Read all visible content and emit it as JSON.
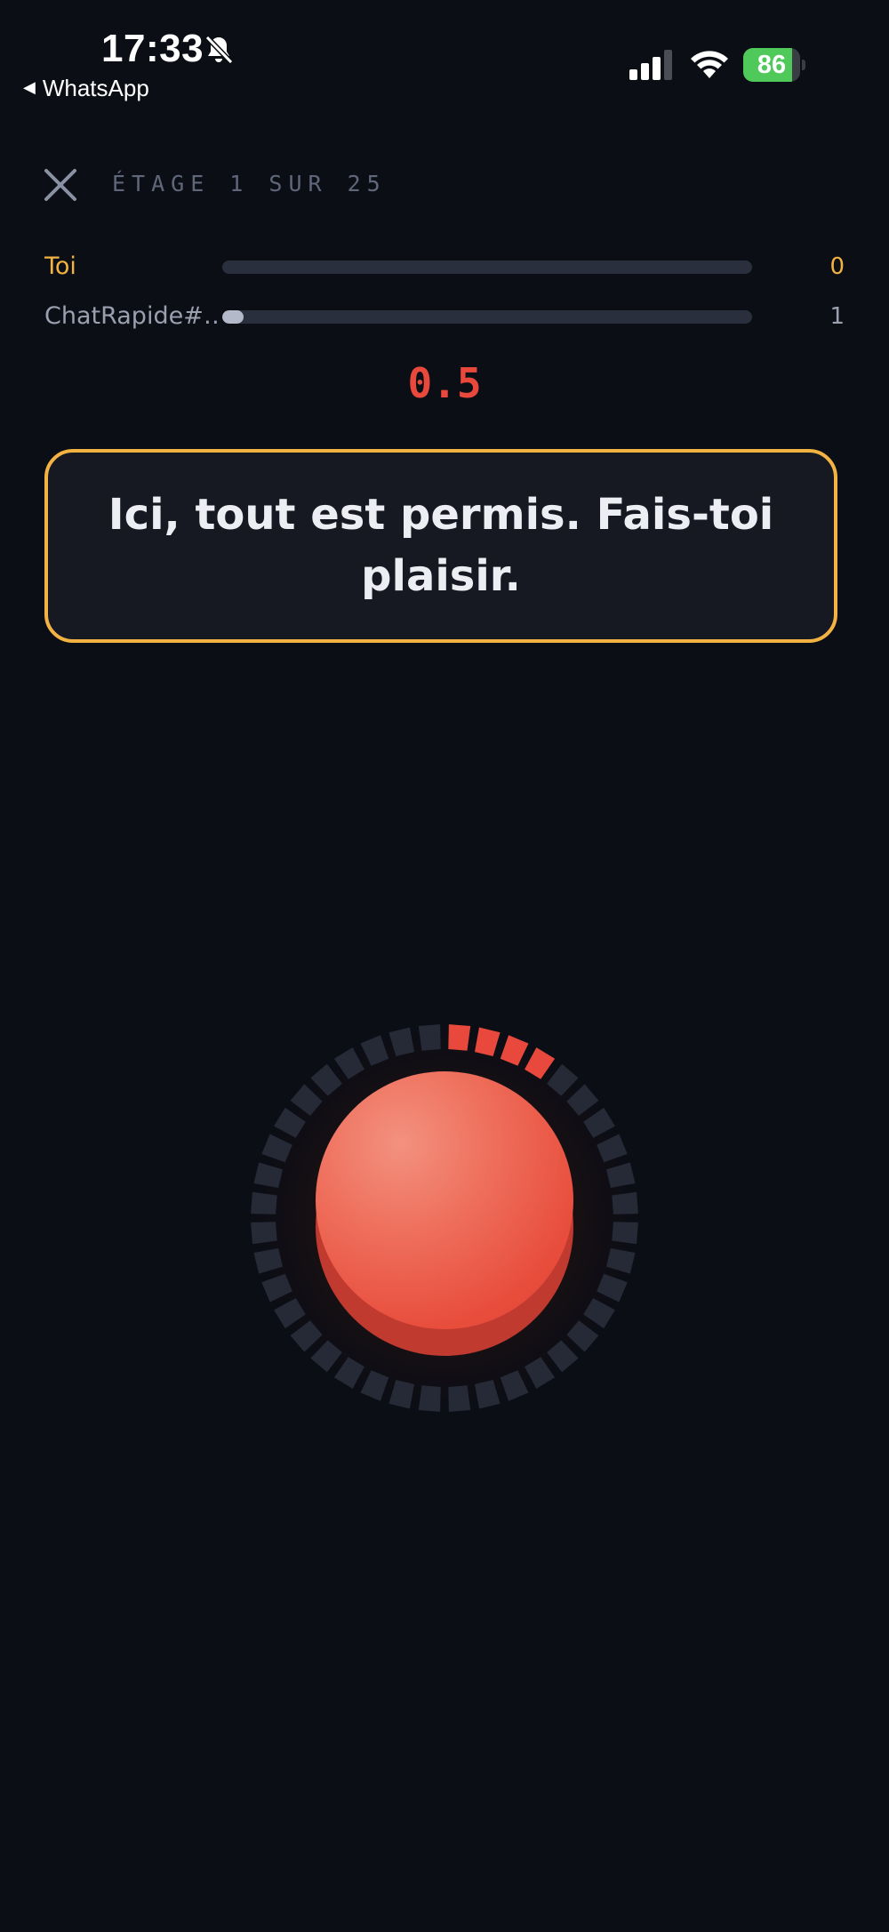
{
  "status_bar": {
    "time": "17:33",
    "back_app": "WhatsApp",
    "battery_percent": "86",
    "battery_level": 0.86,
    "icons": [
      "bell-slash-icon",
      "signal-icon",
      "wifi-icon",
      "battery-charging-icon"
    ]
  },
  "header": {
    "close_icon": "close-icon",
    "stage_label": "ÉTAGE 1 SUR 25"
  },
  "players": [
    {
      "name": "Toi",
      "score": "0",
      "progress": 0.0,
      "color": "#f2b342"
    },
    {
      "name": "ChatRapide#…",
      "score": "1",
      "progress": 0.04,
      "color": "#9aa0b0"
    }
  ],
  "timer": {
    "value": "0.5",
    "color": "#e8493c"
  },
  "message": {
    "text": "Ici, tout est permis. Fais-toi plaisir."
  },
  "dial": {
    "segments": 40,
    "active_segments": 4,
    "active_color": "#e8493c",
    "inactive_color": "#262a36"
  },
  "button": {
    "color": "#e84c3b",
    "icon": "big-red-button"
  },
  "colors": {
    "background": "#0c0e15",
    "accent": "#f2b342",
    "danger": "#e8493c"
  }
}
